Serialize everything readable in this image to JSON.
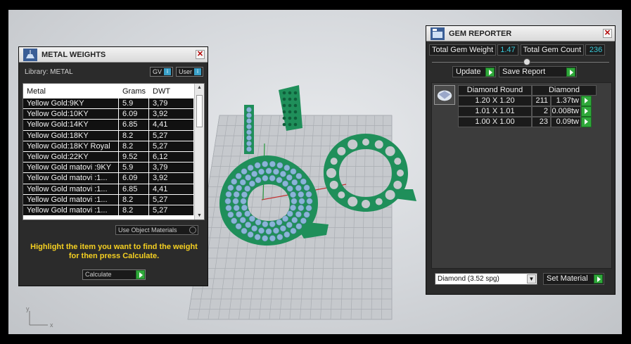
{
  "metal_weights": {
    "title": "METAL WEIGHTS",
    "close_glyph": "✕",
    "library_label": "Library: METAL",
    "toggles": [
      {
        "label": "GV"
      },
      {
        "label": "User"
      }
    ],
    "columns": [
      "Metal",
      "Grams",
      "DWT"
    ],
    "rows": [
      {
        "metal": "Yellow Gold:9KY",
        "grams": "5.9",
        "dwt": "3,79"
      },
      {
        "metal": "Yellow Gold:10KY",
        "grams": "6.09",
        "dwt": "3,92"
      },
      {
        "metal": "Yellow Gold:14KY",
        "grams": "6.85",
        "dwt": "4,41"
      },
      {
        "metal": "Yellow Gold:18KY",
        "grams": "8.2",
        "dwt": "5,27"
      },
      {
        "metal": "Yellow Gold:18KY Royal",
        "grams": "8.2",
        "dwt": "5,27"
      },
      {
        "metal": "Yellow Gold:22KY",
        "grams": "9.52",
        "dwt": "6,12"
      },
      {
        "metal": "Yellow Gold matovi :9KY",
        "grams": "5.9",
        "dwt": "3,79"
      },
      {
        "metal": "Yellow Gold matovi :1...",
        "grams": "6.09",
        "dwt": "3,92"
      },
      {
        "metal": "Yellow Gold matovi :1...",
        "grams": "6.85",
        "dwt": "4,41"
      },
      {
        "metal": "Yellow Gold matovi :1...",
        "grams": "8.2",
        "dwt": "5,27"
      },
      {
        "metal": "Yellow Gold matovi :1...",
        "grams": "8.2",
        "dwt": "5,27"
      }
    ],
    "use_object_materials": "Use Object Materials",
    "hint": "Highlight the item you want to find the weight for then press Calculate.",
    "calculate_label": "Calculate"
  },
  "gem_reporter": {
    "title": "GEM REPORTER",
    "close_glyph": "✕",
    "total_weight_label": "Total Gem Weight",
    "total_weight_value": "1.47",
    "total_count_label": "Total Gem Count",
    "total_count_value": "236",
    "update_label": "Update",
    "save_report_label": "Save Report",
    "table_headers": [
      "Diamond Round",
      "Diamond"
    ],
    "gems": [
      {
        "size": "1.20 X 1.20",
        "count": "211",
        "weight": "1.37tw"
      },
      {
        "size": "1.01 X 1.01",
        "count": "2",
        "weight": "0.008tw"
      },
      {
        "size": "1.00 X 1.00",
        "count": "23",
        "weight": "0.09tw"
      }
    ],
    "material_value": "Diamond     (3.52 spg)",
    "set_material_label": "Set Material"
  },
  "viewport": {
    "axis_x": "x",
    "axis_y": "y",
    "model_color": "#1f8f5a",
    "gem_color": "#8ab4d8"
  }
}
